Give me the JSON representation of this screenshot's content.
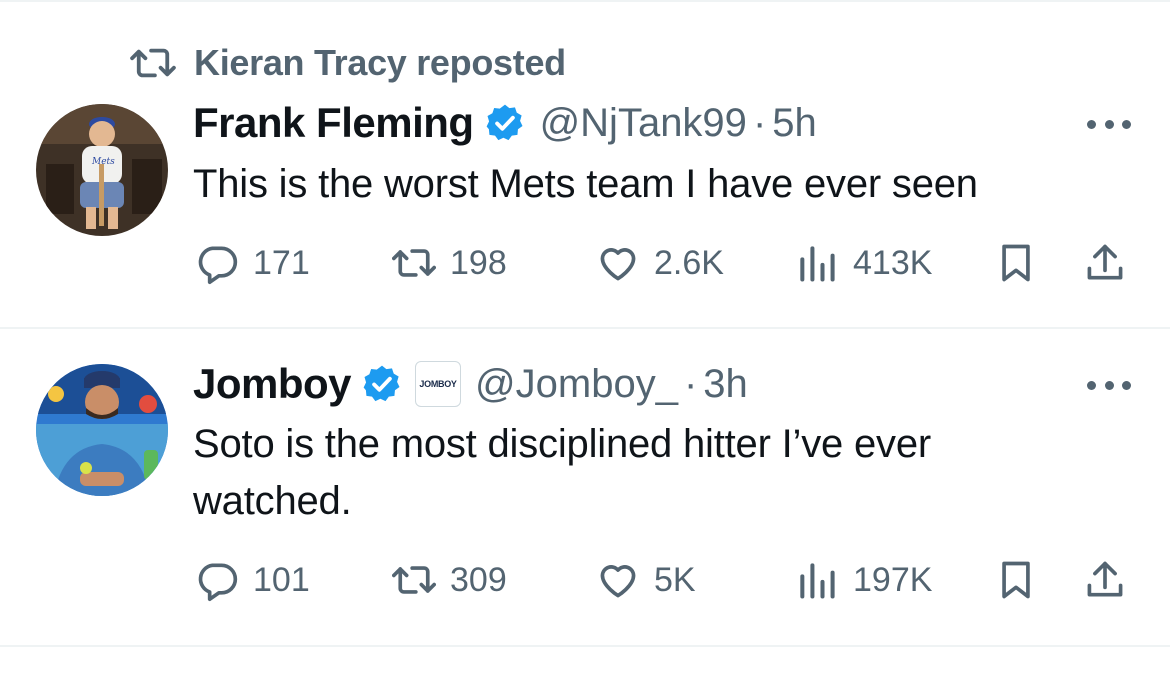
{
  "repost_banner": {
    "text": "Kieran Tracy reposted",
    "icon": "repost-icon"
  },
  "tweets": [
    {
      "name": "Frank Fleming",
      "handle": "@NjTank99",
      "separator": "·",
      "time": "5h",
      "text": "This is the worst Mets team I have ever seen",
      "replies": "171",
      "reposts": "198",
      "likes": "2.6K",
      "views": "413K"
    },
    {
      "name": "Jomboy",
      "affiliate_badge": "JOMBOY",
      "handle": "@Jomboy_",
      "separator": "·",
      "time": "3h",
      "text_line1": "Soto is the most disciplined hitter I’ve ever",
      "text_line2": "watched.",
      "replies": "101",
      "reposts": "309",
      "likes": "5K",
      "views": "197K"
    }
  ],
  "colors": {
    "verified": "#1d9bf0",
    "muted": "#536471",
    "text": "#0f1419",
    "divider": "#eff3f4"
  }
}
